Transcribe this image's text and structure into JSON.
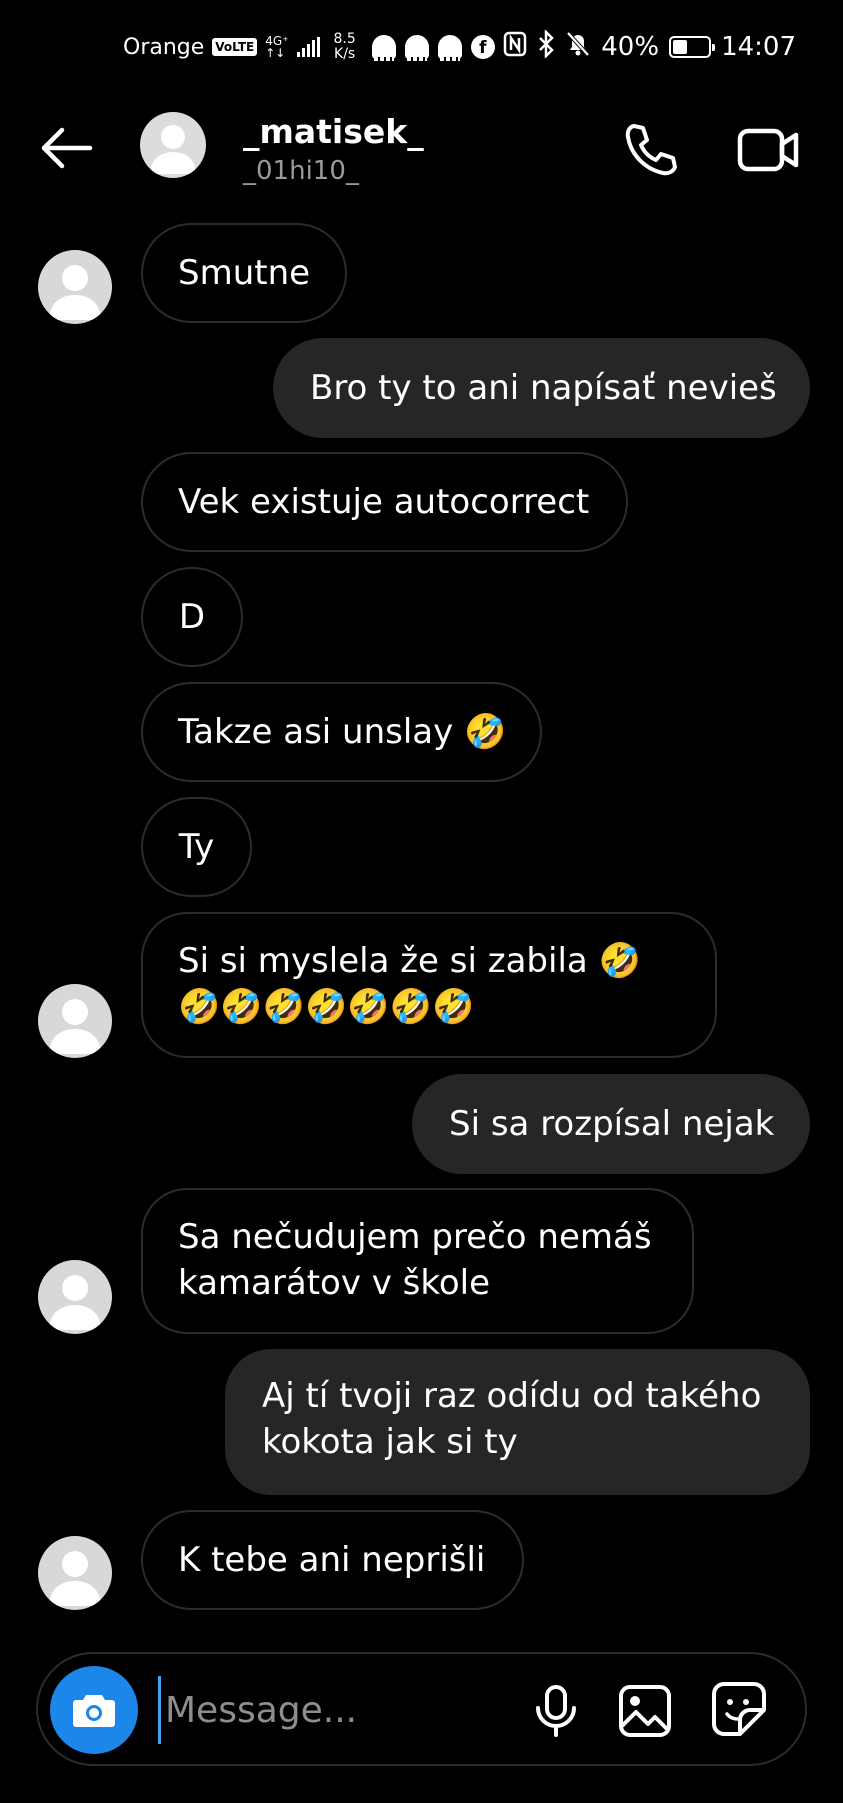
{
  "status_bar": {
    "carrier": "Orange",
    "volte": "VoLTE",
    "network": "4G⁺",
    "network_sub": "↑↓",
    "speed_value": "8.5",
    "speed_unit": "K/s",
    "battery_percent": "40%",
    "battery_level": 0.4,
    "time": "14:07"
  },
  "header": {
    "display_name": "_matisek_",
    "username": "_01hi10_"
  },
  "messages": [
    {
      "from": "them",
      "text": "Smutne"
    },
    {
      "from": "me",
      "text": "Bro ty to ani napísať nevieš"
    },
    {
      "from": "them",
      "text": "Vek existuje autocorrect"
    },
    {
      "from": "them",
      "text": "D"
    },
    {
      "from": "them",
      "text": "Takze asi unslay 🤣"
    },
    {
      "from": "them",
      "text": "Ty"
    },
    {
      "from": "them",
      "text": "Si si myslela že si zabila 🤣🤣🤣🤣🤣🤣🤣🤣"
    },
    {
      "from": "me",
      "text": "Si sa rozpísal nejak"
    },
    {
      "from": "them",
      "text": "Sa nečudujem prečo nemáš kamarátov v škole"
    },
    {
      "from": "me",
      "text": "Aj tí tvoji raz odídu od takého kokota jak si ty"
    },
    {
      "from": "them",
      "text": "K tebe ani neprišli"
    }
  ],
  "composer": {
    "placeholder": "Message..."
  },
  "icons": {
    "back": "arrow-left-icon",
    "call": "phone-icon",
    "video": "video-camera-icon",
    "camera": "camera-icon",
    "mic": "microphone-icon",
    "gallery": "image-icon",
    "sticker": "sticker-icon"
  },
  "colors": {
    "background": "#000000",
    "outgoing_bubble": "#262626",
    "incoming_border": "#2c2c2c",
    "camera_button": "#1c87e8",
    "username": "#9a9a9a"
  }
}
